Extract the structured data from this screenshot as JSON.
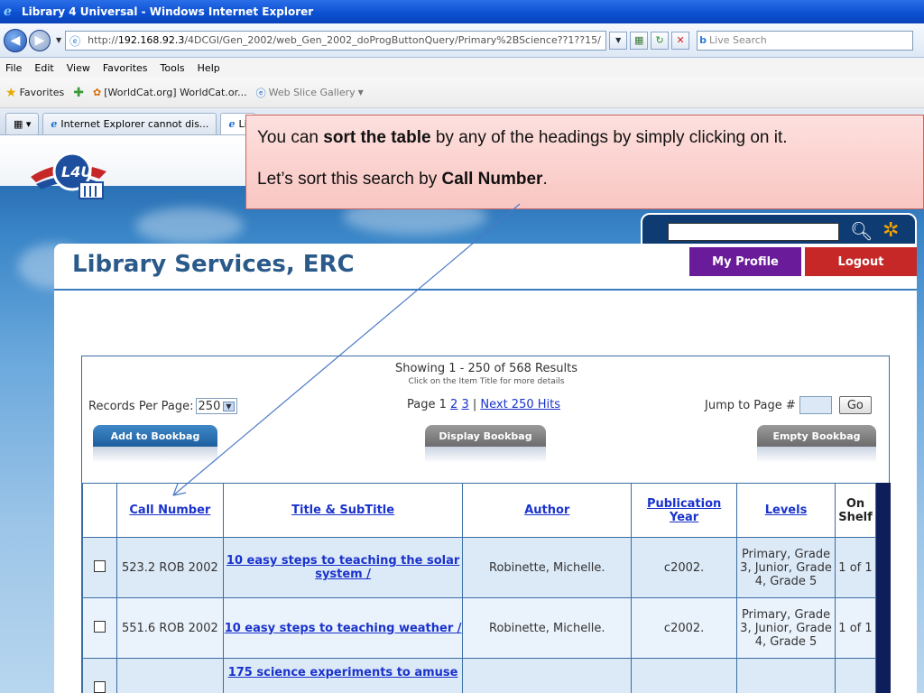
{
  "window": {
    "title": "Library 4 Universal - Windows Internet Explorer",
    "url_prefix": "http://",
    "url_host": "192.168.92.3",
    "url_path": "/4DCGI/Gen_2002/web_Gen_2002_doProgButtonQuery/Primary%2BScience??1??15/",
    "search_placeholder": "Live Search"
  },
  "menu": [
    "File",
    "Edit",
    "View",
    "Favorites",
    "Tools",
    "Help"
  ],
  "favorites": {
    "label": "Favorites",
    "items": [
      "[WorldCat.org] WorldCat.or...",
      "Web Slice Gallery"
    ]
  },
  "tabs": [
    {
      "label": "Internet Explorer cannot dis..."
    },
    {
      "label": "Li"
    }
  ],
  "callout": {
    "line1_pre": "You can ",
    "line1_bold": "sort the table",
    "line1_post": " by any of the headings by simply clicking on it.",
    "line2_pre": "Let’s sort this search by  ",
    "line2_bold": "Call Number",
    "line2_post": "."
  },
  "page": {
    "title": "Library Services, ERC",
    "my_profile": "My Profile",
    "logout": "Logout",
    "showing": "Showing 1 - 250 of 568 Results",
    "click_hint": "Click on the Item Title for more details",
    "records_per_page_label": "Records Per Page:",
    "records_per_page_value": "250",
    "pager_prefix": "Page 1 ",
    "pager_p2": "2",
    "pager_p3": "3",
    "pager_sep": " | ",
    "pager_next": "Next 250 Hits",
    "jump_label": "Jump to Page #",
    "go": "Go",
    "add_to_bookbag": "Add to Bookbag",
    "display_bookbag": "Display Bookbag",
    "empty_bookbag": "Empty Bookbag"
  },
  "table": {
    "headers": {
      "call_number": "Call Number",
      "title": "Title & SubTitle",
      "author": "Author",
      "pub_year": "Publication Year",
      "levels": "Levels",
      "on_shelf": "On Shelf"
    },
    "rows": [
      {
        "call_number": "523.2 ROB 2002",
        "title": "10 easy steps to teaching the solar system /",
        "author": "Robinette, Michelle.",
        "year": "c2002.",
        "levels": "Primary, Grade 3, Junior, Grade 4, Grade 5",
        "shelf": "1 of 1"
      },
      {
        "call_number": "551.6 ROB 2002",
        "title": "10 easy steps to teaching weather /",
        "author": "Robinette, Michelle.",
        "year": "c2002.",
        "levels": "Primary, Grade 3, Junior, Grade 4, Grade 5",
        "shelf": "1 of 1"
      },
      {
        "call_number": "",
        "title": "175 science experiments to amuse",
        "author": "",
        "year": "",
        "levels": "",
        "shelf": ""
      }
    ]
  }
}
